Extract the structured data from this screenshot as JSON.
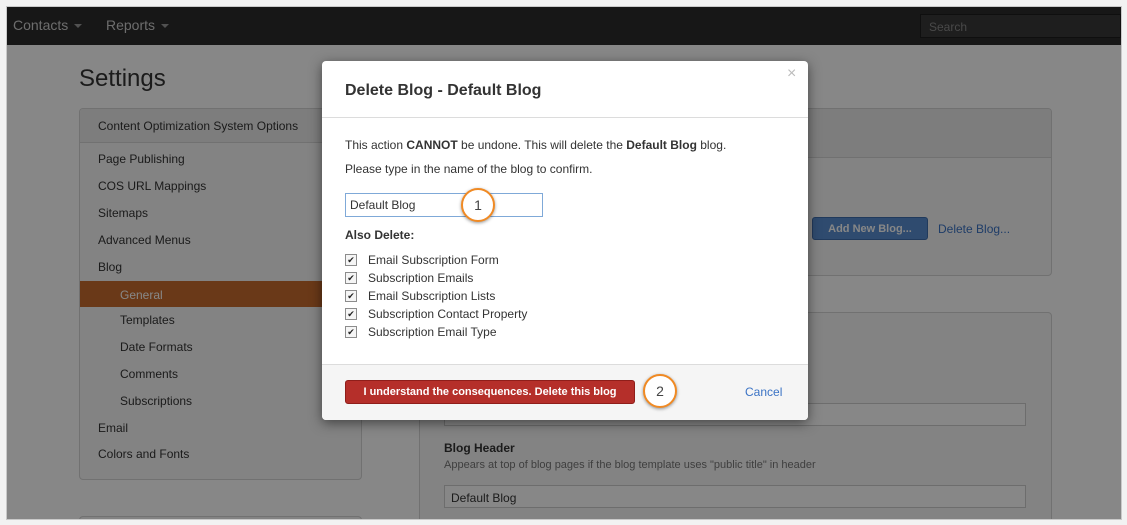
{
  "topbar": {
    "nav": [
      {
        "label": "Contacts"
      },
      {
        "label": "Reports"
      }
    ],
    "search_placeholder": "Search"
  },
  "page_title": "Settings",
  "sidebar": {
    "header": "Content Optimization System Options",
    "items": [
      {
        "label": "Page Publishing"
      },
      {
        "label": "COS URL Mappings"
      },
      {
        "label": "Sitemaps"
      },
      {
        "label": "Advanced Menus"
      },
      {
        "label": "Blog"
      },
      {
        "label": "General"
      },
      {
        "label": "Templates"
      },
      {
        "label": "Date Formats"
      },
      {
        "label": "Comments"
      },
      {
        "label": "Subscriptions"
      },
      {
        "label": "Email"
      },
      {
        "label": "Colors and Fonts"
      }
    ],
    "active": "General"
  },
  "blog_panel": {
    "add_button": "Add New Blog...",
    "delete_link": "Delete Blog..."
  },
  "settings_panel": {
    "blog_header_label": "Blog Header",
    "blog_header_help": "Appears at top of blog pages if the blog template uses \"public title\" in header",
    "blog_header_value": "Default Blog"
  },
  "modal": {
    "title": "Delete Blog - Default Blog",
    "warning_prefix": "This action ",
    "warning_strong": "CANNOT",
    "warning_middle": " be undone. This will delete the ",
    "warning_blog": "Default Blog",
    "warning_suffix": " blog.",
    "confirm_text": "Please type in the name of the blog to confirm.",
    "input_value": "Default Blog",
    "also_delete_label": "Also Delete:",
    "checkboxes": [
      {
        "label": "Email Subscription Form",
        "checked": true
      },
      {
        "label": "Subscription Emails",
        "checked": true
      },
      {
        "label": "Email Subscription Lists",
        "checked": true
      },
      {
        "label": "Subscription Contact Property",
        "checked": true
      },
      {
        "label": "Subscription Email Type",
        "checked": true
      }
    ],
    "delete_button": "I understand the consequences. Delete this blog",
    "cancel": "Cancel",
    "close": "×"
  },
  "callouts": [
    "1",
    "2"
  ],
  "colors": {
    "accent_orange": "#f08a24",
    "danger_red": "#b52f2a",
    "primary_blue": "#5a8fd1",
    "active_nav": "#c96d2e"
  }
}
